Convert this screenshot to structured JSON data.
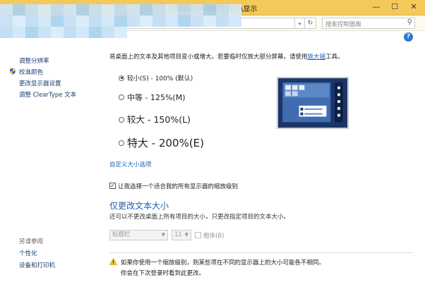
{
  "window": {
    "title": "控制面板\\外观和个性化\\显示",
    "minimize_glyph": "—",
    "maximize_glyph": "☐",
    "close_glyph": "✕"
  },
  "addressbar": {
    "search_placeholder": "搜索控制面板",
    "refresh_glyph": "↻",
    "dropdown_glyph": "▾"
  },
  "help": {
    "glyph": "?"
  },
  "sidebar": {
    "items": [
      {
        "label": "调整分辨率"
      },
      {
        "label": "校准颜色",
        "icon": "shield-icon"
      },
      {
        "label": "更改显示器设置"
      },
      {
        "label": "调整 ClearType 文本"
      }
    ],
    "see_also_title": "另请参阅",
    "see_also": [
      {
        "label": "个性化"
      },
      {
        "label": "设备和打印机"
      }
    ]
  },
  "main": {
    "description_prefix": "将桌面上的文本及其他项目变小或增大。若要临时仅放大部分屏幕，请使用",
    "description_link": "放大镜",
    "description_suffix": "工具。",
    "size_options": [
      {
        "label": "较小(S) - 100% (默认)",
        "selected": true
      },
      {
        "label": "中等 - 125%(M)",
        "selected": false
      },
      {
        "label": "较大 - 150%(L)",
        "selected": false
      },
      {
        "label": "特大 - 200%(E)",
        "selected": false
      }
    ],
    "custom_size_link": "自定义大小选项",
    "scaling_checkbox": {
      "label": "让我选择一个适合我的所有显示器的缩放级别",
      "checked": true,
      "glyph": "✓"
    },
    "text_only_title": "仅更改文本大小",
    "text_only_desc": "还可以不更改桌面上所有项目的大小，只更改指定项目的文本大小。",
    "element_select": {
      "value": "标题栏",
      "disabled": true
    },
    "size_select": {
      "value": "11",
      "disabled": true
    },
    "bold_checkbox": {
      "label": "粗体(B)",
      "checked": false,
      "disabled": true
    },
    "warning_line1": "如果你使用一个缩放级别，则某些项在不同的显示器上的大小可能各不相同。",
    "warning_line2": "你会在下次登录时看到此更改。"
  },
  "colors": {
    "titlebar": "#f2c95a",
    "link": "#1a5fb4",
    "preview_bg": "#1c3568",
    "warning": "#f3c623"
  }
}
